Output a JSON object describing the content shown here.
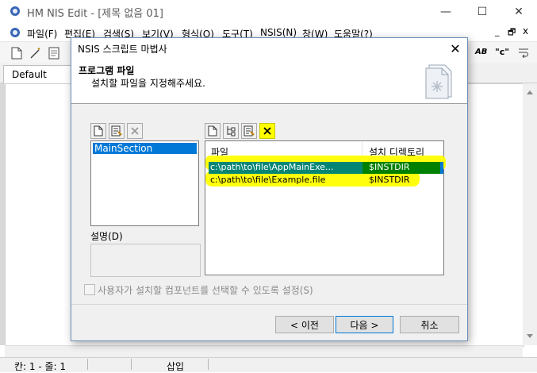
{
  "window": {
    "title": "HM NIS Edit - [제목 없음 01]",
    "minimize": "—",
    "maximize": "☐",
    "close": "✕",
    "child_minimize": "_",
    "child_restore": "🗗",
    "child_close": "x"
  },
  "menu": [
    "파일(F)",
    "편집(E)",
    "검색(S)",
    "보기(V)",
    "형식(O)",
    "도구(T)",
    "NSIS(N)",
    "창(W)",
    "도움말(?)"
  ],
  "toolbar": {
    "text_ab": "AB",
    "text_quote": "\"c\""
  },
  "editor_tab": "Default",
  "status": {
    "position": "칸: 1 - 줄: 1",
    "mode": "삽입"
  },
  "dialog": {
    "title": "NSIS 스크립트 마법사",
    "close": "✕",
    "header_title": "프로그램 파일",
    "header_subtitle": "설치할 파일을 지정해주세요.",
    "sections": [
      "MainSection"
    ],
    "description_label": "설명(D)",
    "file_columns": [
      "파일",
      "설치 디렉토리"
    ],
    "files": [
      {
        "file": "c:\\path\\to\\file\\AppMainExe...",
        "dir": "$INSTDIR",
        "selected": true
      },
      {
        "file": "c:\\path\\to\\file\\Example.file",
        "dir": "$INSTDIR",
        "selected": false
      }
    ],
    "checkbox_label": "사용자가 설치할 컴포넌트를 선택할 수 있도록 설정(S)",
    "buttons": {
      "back": "< 이전",
      "next": "다음 >",
      "cancel": "취소"
    }
  },
  "colors": {
    "selection": "#0078d7",
    "highlight": "#ffff00",
    "selected_row_green": "#008000"
  }
}
